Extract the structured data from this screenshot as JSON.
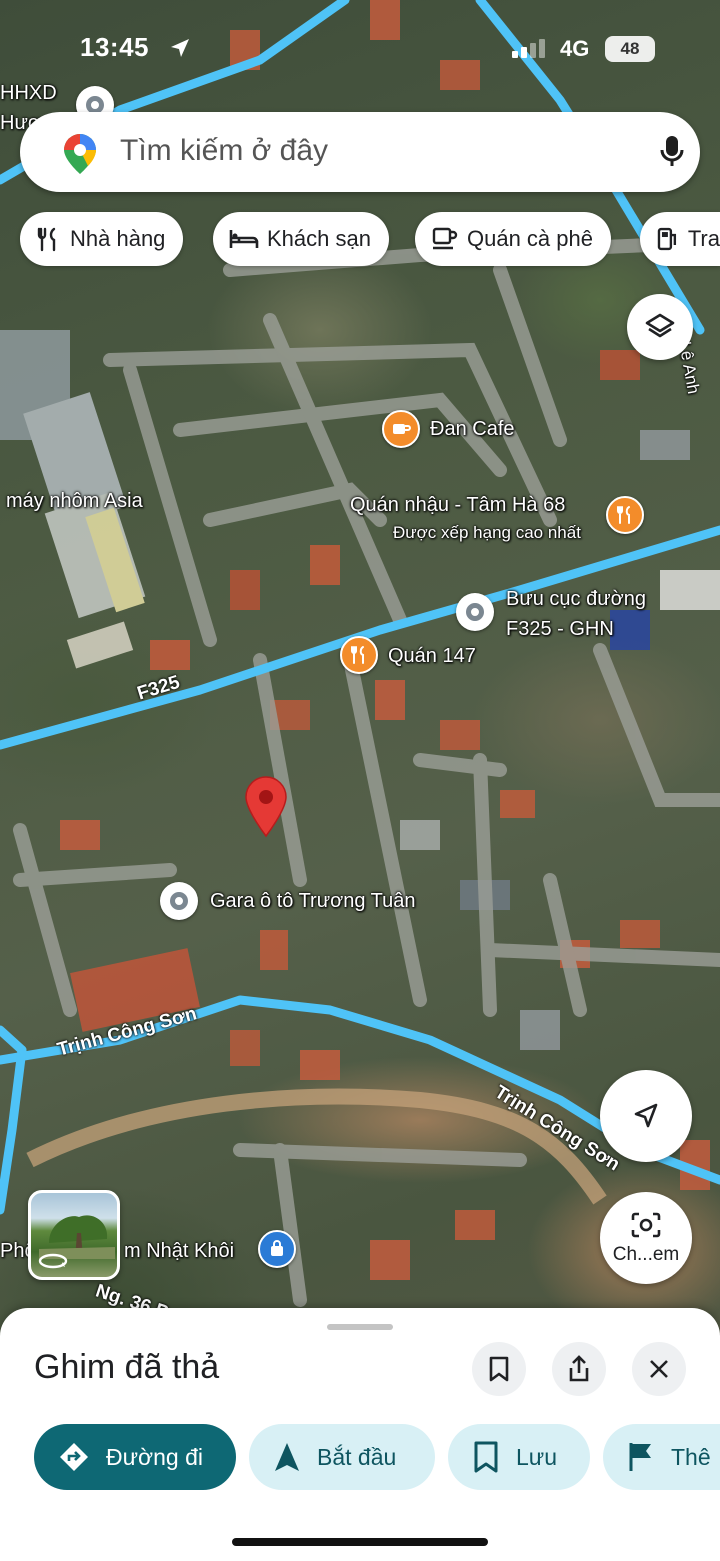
{
  "status_bar": {
    "time": "13:45",
    "network": "4G",
    "battery": "48"
  },
  "search": {
    "placeholder": "Tìm kiếm ở đây"
  },
  "chips": [
    {
      "label": "Nhà hàng",
      "icon": "fork-knife-icon"
    },
    {
      "label": "Khách sạn",
      "icon": "bed-icon"
    },
    {
      "label": "Quán cà phê",
      "icon": "coffee-cup-icon"
    },
    {
      "label": "Tra",
      "icon": "gas-station-icon"
    }
  ],
  "map": {
    "places": [
      {
        "name": "Đan Cafe",
        "type": "cafe"
      },
      {
        "name": "Quán nhậu - Tâm Hà 68",
        "subtitle": "Được xếp hạng cao nhất",
        "type": "restaurant"
      },
      {
        "name": "Bưu cục đường",
        "name2": "F325 - GHN",
        "type": "generic"
      },
      {
        "name": "Quán 147",
        "type": "restaurant"
      },
      {
        "name": "Gara ô tô Trương Tuân",
        "type": "generic"
      },
      {
        "name": "máy nhôm Asia",
        "type": "label"
      },
      {
        "name": "HHXD",
        "name2": "Hươ",
        "type": "generic"
      },
      {
        "name": "Phố",
        "name2": "m Nhật Khôi",
        "type": "shopping"
      },
      {
        "name": "Ng. 36 P",
        "type": "label"
      },
      {
        "name": "Lê Anh",
        "type": "label"
      }
    ],
    "roads": [
      "F325",
      "Trịnh Công Sơn",
      "Trịnh Công Sơn"
    ]
  },
  "buttons": {
    "camera_label": "Ch...em"
  },
  "sheet": {
    "title": "Ghim đã thả",
    "actions": [
      {
        "label": "Đường đi",
        "icon": "directions-icon"
      },
      {
        "label": "Bắt đầu",
        "icon": "navigation-arrow-icon"
      },
      {
        "label": "Lưu",
        "icon": "bookmark-icon"
      },
      {
        "label": "Thê",
        "icon": "flag-icon"
      }
    ]
  },
  "colors": {
    "road": "#4fc3f7",
    "primary": "#0e6874",
    "secondary_bg": "#d8f0f5",
    "pin": "#e53935",
    "poi_orange": "#f38c2a"
  }
}
